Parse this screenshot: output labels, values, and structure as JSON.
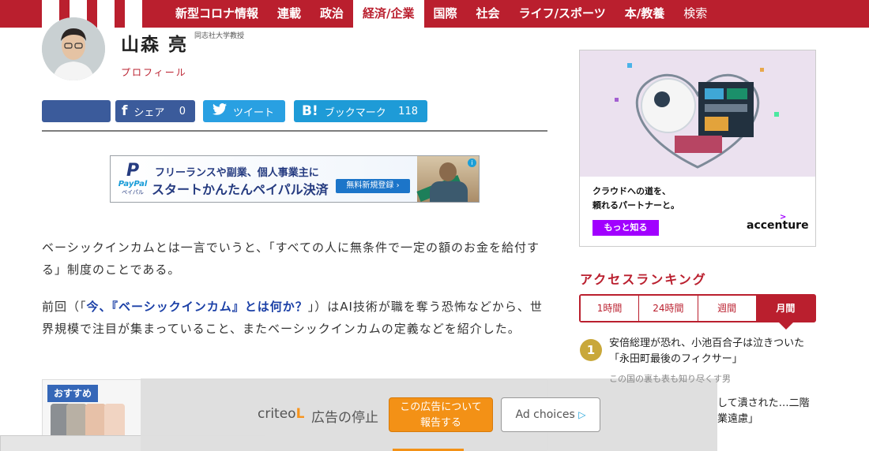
{
  "nav": {
    "items": [
      {
        "label": "新型コロナ情報"
      },
      {
        "label": "連載"
      },
      {
        "label": "政治"
      },
      {
        "label": "経済/企業"
      },
      {
        "label": "国際"
      },
      {
        "label": "社会"
      },
      {
        "label": "ライフ/スポーツ"
      },
      {
        "label": "本/教養"
      },
      {
        "label": "検索"
      }
    ],
    "active": "経済/企業"
  },
  "author": {
    "name": "山森 亮",
    "title": "同志社大学教授",
    "profile_link": "プロフィール"
  },
  "share": {
    "facebook_label": "シェア",
    "facebook_count": "0",
    "twitter_label": "ツイート",
    "hatena_icon": "B!",
    "hatena_label": "ブックマーク",
    "hatena_count": "118"
  },
  "banner_ad": {
    "logo": "P",
    "logo_word": "PayPal",
    "logo_sub": "ペイパル",
    "line1": "フリーランスや副業、個人事業主に",
    "line2": "スタートかんたんペイパル決済",
    "cta": "無料新規登録 ›",
    "info_icon": "i"
  },
  "article": {
    "paragraph1": "ベーシックインカムとは一言でいうと、「すべての人に無条件で一定の額のお金を給付する」制度のことである。",
    "paragraph2_before": "前回（「",
    "paragraph2_link": "今、『ベーシックインカム』とは何か？",
    "paragraph2_after": "」）はAI技術が職を奪う恐怖などから、世界規模で注目が集まっていること、またベーシックインカムの定義などを紹介した。"
  },
  "recommend": {
    "badge": "おすすめ"
  },
  "criteo": {
    "logo_text": "criteo",
    "logo_mark": "L",
    "stop_label": "広告の停止",
    "report_label_line1": "この広告について",
    "report_label_line2": "報告する",
    "choices_label": "Ad choices",
    "choices_icon": "▷"
  },
  "side_ad": {
    "text_line1": "クラウドへの道を、",
    "text_line2": "頼れるパートナーと。",
    "button": "もっと知る",
    "logo": "accenture",
    "logo_mark": ">"
  },
  "ranking": {
    "heading": "アクセスランキング",
    "tabs": [
      {
        "label": "1時間"
      },
      {
        "label": "24時間"
      },
      {
        "label": "週間"
      },
      {
        "label": "月間"
      }
    ],
    "active_tab": "月間",
    "items": [
      {
        "rank": "1",
        "title": "安倍総理が恐れ、小池百合子は泣きついた「永田町最後のフィクサー」",
        "subtitle": "この国の裏も表も知り尽くす男"
      }
    ],
    "partial_line1": "して潰された…二階",
    "partial_line2": "業遠慮」"
  },
  "colors": {
    "brand_red": "#ba1f2e",
    "facebook": "#3b5b9b",
    "twitter": "#29a0e2",
    "hatena": "#1e9bd7",
    "accenture_purple": "#a100ff",
    "criteo_orange": "#f39116"
  }
}
